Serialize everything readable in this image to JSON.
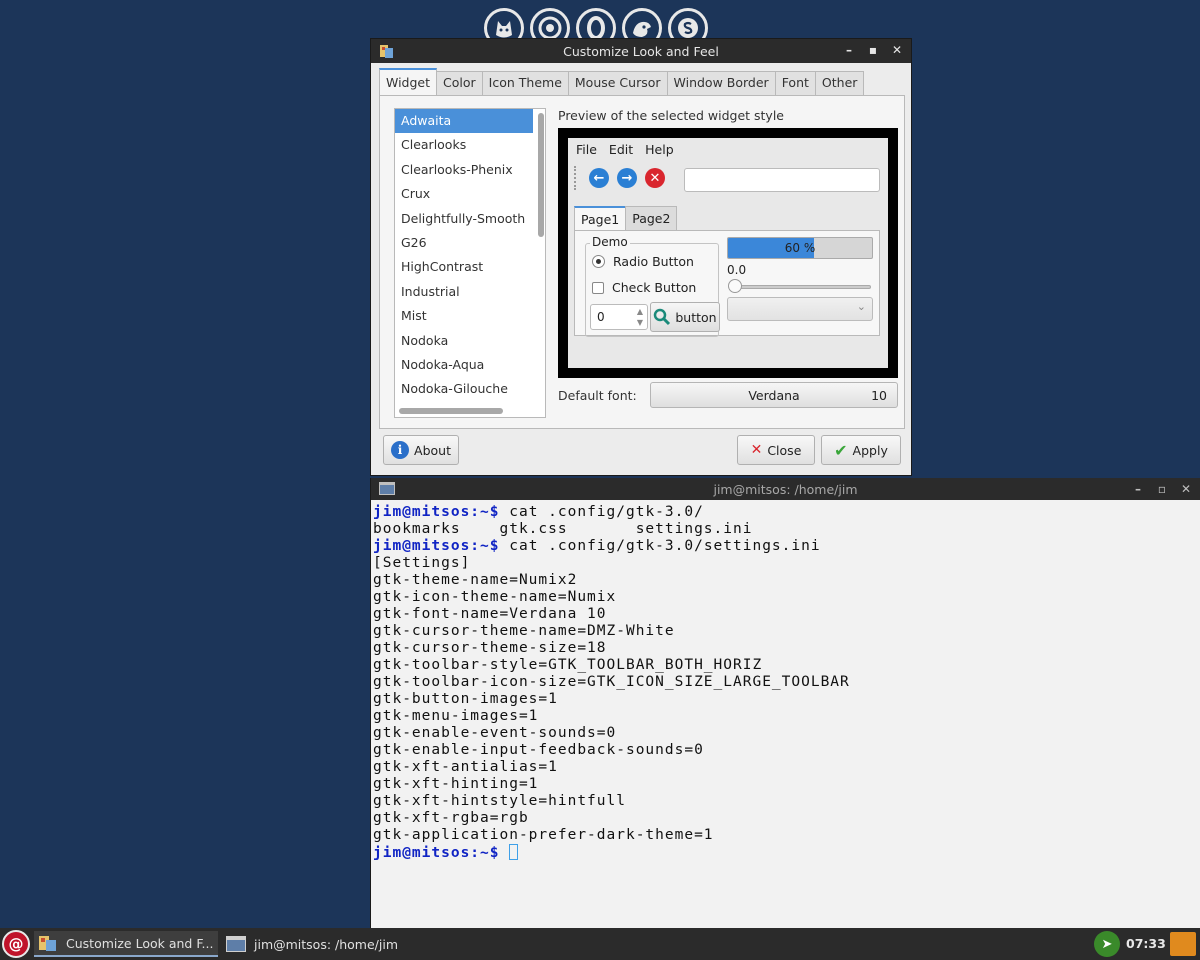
{
  "dialog": {
    "title": "Customize Look and Feel",
    "tabs": [
      {
        "label": "Widget",
        "active": true
      },
      {
        "label": "Color"
      },
      {
        "label": "Icon Theme"
      },
      {
        "label": "Mouse Cursor"
      },
      {
        "label": "Window Border"
      },
      {
        "label": "Font"
      },
      {
        "label": "Other"
      }
    ],
    "themes": [
      {
        "label": "Adwaita",
        "selected": true
      },
      {
        "label": "Clearlooks"
      },
      {
        "label": "Clearlooks-Phenix"
      },
      {
        "label": "Crux"
      },
      {
        "label": "Delightfully-Smooth"
      },
      {
        "label": "G26"
      },
      {
        "label": "HighContrast"
      },
      {
        "label": "Industrial"
      },
      {
        "label": "Mist"
      },
      {
        "label": "Nodoka"
      },
      {
        "label": "Nodoka-Aqua"
      },
      {
        "label": "Nodoka-Gilouche"
      }
    ],
    "preview_label": "Preview of the selected widget style",
    "preview": {
      "menu": [
        "File",
        "Edit",
        "Help"
      ],
      "tabs": [
        "Page1",
        "Page2"
      ],
      "demo_legend": "Demo",
      "radio_label": "Radio Button",
      "check_label": "Check Button",
      "spin_value": "0",
      "button_label": "button",
      "progress_text": "60 %",
      "progress_fraction": 0.6,
      "scale_value": "0.0"
    },
    "default_font_label": "Default font:",
    "font_name": "Verdana",
    "font_size": "10",
    "buttons": {
      "about": "About",
      "close": "Close",
      "apply": "Apply"
    }
  },
  "terminal": {
    "title": "jim@mitsos: /home/jim",
    "prompt": "jim@mitsos:~$",
    "lines": [
      {
        "prompt": true,
        "text": " cat .config/gtk-3.0/"
      },
      {
        "text": "bookmarks    gtk.css       settings.ini"
      },
      {
        "prompt": true,
        "text": " cat .config/gtk-3.0/settings.ini"
      },
      {
        "text": "[Settings]"
      },
      {
        "text": "gtk-theme-name=Numix2"
      },
      {
        "text": "gtk-icon-theme-name=Numix"
      },
      {
        "text": "gtk-font-name=Verdana 10"
      },
      {
        "text": "gtk-cursor-theme-name=DMZ-White"
      },
      {
        "text": "gtk-cursor-theme-size=18"
      },
      {
        "text": "gtk-toolbar-style=GTK_TOOLBAR_BOTH_HORIZ"
      },
      {
        "text": "gtk-toolbar-icon-size=GTK_ICON_SIZE_LARGE_TOOLBAR"
      },
      {
        "text": "gtk-button-images=1"
      },
      {
        "text": "gtk-menu-images=1"
      },
      {
        "text": "gtk-enable-event-sounds=0"
      },
      {
        "text": "gtk-enable-input-feedback-sounds=0"
      },
      {
        "text": "gtk-xft-antialias=1"
      },
      {
        "text": "gtk-xft-hinting=1"
      },
      {
        "text": "gtk-xft-hintstyle=hintfull"
      },
      {
        "text": "gtk-xft-rgba=rgb"
      },
      {
        "text": "gtk-application-prefer-dark-theme=1"
      },
      {
        "prompt": true,
        "text": " ",
        "cursor": true
      }
    ]
  },
  "taskbar": {
    "tasks": [
      {
        "label": "Customize Look and F...",
        "icon": "appearance-icon",
        "active": true
      },
      {
        "label": "jim@mitsos: /home/jim",
        "icon": "terminal-icon"
      }
    ],
    "clock": "07:33"
  },
  "dock_icons": [
    "firefox-icon",
    "chrome-icon",
    "opera-icon",
    "gimp-icon",
    "skype-icon"
  ]
}
